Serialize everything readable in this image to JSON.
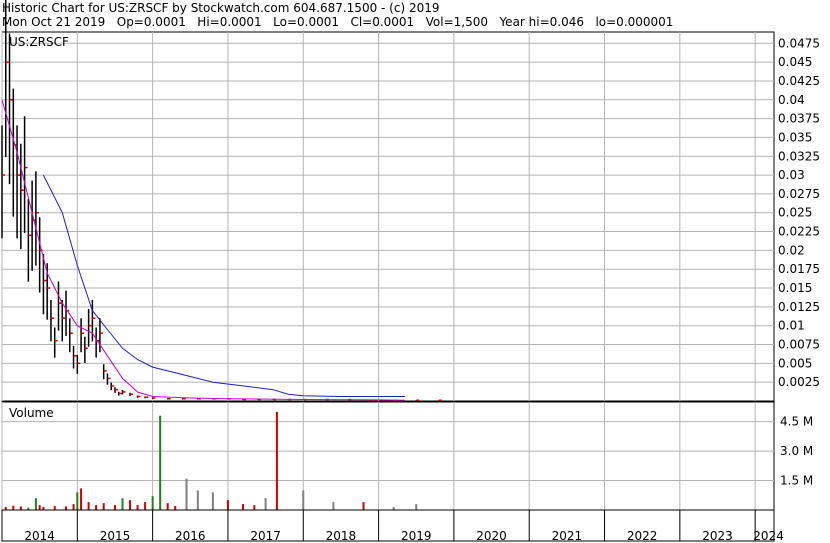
{
  "header": {
    "line1": "Historic Chart for US:ZRSCF by Stockwatch.com 604.687.1500 - (c) 2019",
    "line2": "Mon Oct 21 2019   Op=0.0001   Hi=0.0001   Lo=0.0001   Cl=0.0001   Vol=1,500   Year hi=0.046   lo=0.000001"
  },
  "colors": {
    "grid": "#b4b4b4",
    "up": "#208020",
    "down": "#d00000",
    "neutral": "#808080",
    "ma_short": "#d000d0",
    "ma_long": "#2020c0",
    "price_bar": "#000000"
  },
  "chart_data": [
    {
      "type": "line",
      "title": "US:ZRSCF",
      "y_ticks": [
        "0.0475",
        "0.045",
        "0.0425",
        "0.04",
        "0.0375",
        "0.035",
        "0.0325",
        "0.03",
        "0.0275",
        "0.025",
        "0.0225",
        "0.02",
        "0.0175",
        "0.015",
        "0.0125",
        "0.01",
        "0.0075",
        "0.005",
        "0.0025"
      ],
      "ylim": [
        0,
        0.049
      ],
      "x_ticks": [
        "2014",
        "2015",
        "2016",
        "2017",
        "2018",
        "2019",
        "2020",
        "2021",
        "2022",
        "2023",
        "2024"
      ],
      "xlim": [
        2014.0,
        2024.25
      ],
      "grid": true,
      "series": [
        {
          "style": "ohlc",
          "x": [
            2014.0,
            2014.05,
            2014.1,
            2014.15,
            2014.2,
            2014.25,
            2014.3,
            2014.35,
            2014.4,
            2014.45,
            2014.5,
            2014.55,
            2014.6,
            2014.65,
            2014.7,
            2014.75,
            2014.8,
            2014.85,
            2014.9,
            2014.95,
            2015.0,
            2015.05,
            2015.1,
            2015.15,
            2015.2,
            2015.25,
            2015.3,
            2015.35,
            2015.4,
            2015.45,
            2015.5,
            2015.55,
            2015.6,
            2015.7,
            2015.8,
            2015.9,
            2016.0,
            2016.2,
            2016.4,
            2016.6,
            2016.8,
            2017.0,
            2017.2,
            2017.4,
            2017.6,
            2017.8,
            2018.0,
            2018.3,
            2018.6,
            2018.9,
            2019.2,
            2019.5,
            2019.8
          ],
          "y": [
            0.03,
            0.045,
            0.04,
            0.034,
            0.03,
            0.028,
            0.031,
            0.022,
            0.024,
            0.025,
            0.02,
            0.016,
            0.015,
            0.011,
            0.008,
            0.013,
            0.011,
            0.012,
            0.009,
            0.006,
            0.005,
            0.009,
            0.007,
            0.01,
            0.011,
            0.008,
            0.009,
            0.004,
            0.003,
            0.002,
            0.0015,
            0.001,
            0.0012,
            0.0009,
            0.0006,
            0.0005,
            0.0004,
            0.0003,
            0.0003,
            0.0003,
            0.0003,
            0.0003,
            0.0002,
            0.0002,
            0.0002,
            0.0002,
            0.0002,
            0.0002,
            0.0002,
            0.0001,
            0.0001,
            0.0001,
            0.0001
          ]
        },
        {
          "style": "moving-average",
          "color": "#d000d0",
          "x": [
            2014.0,
            2014.2,
            2014.4,
            2014.6,
            2014.8,
            2015.0,
            2015.2,
            2015.4,
            2015.6,
            2015.8,
            2016.0,
            2016.5,
            2017.0,
            2018.0,
            2019.0,
            2019.35
          ],
          "y": [
            0.04,
            0.033,
            0.025,
            0.017,
            0.013,
            0.01,
            0.009,
            0.006,
            0.003,
            0.0012,
            0.0006,
            0.0004,
            0.0003,
            0.0002,
            0.00015,
            0.0001
          ]
        },
        {
          "style": "moving-average",
          "color": "#2020c0",
          "x": [
            2014.55,
            2014.8,
            2015.0,
            2015.2,
            2015.4,
            2015.6,
            2015.8,
            2016.0,
            2016.4,
            2016.8,
            2017.2,
            2017.6,
            2017.8,
            2018.0,
            2018.5,
            2019.0,
            2019.35
          ],
          "y": [
            0.03,
            0.025,
            0.018,
            0.012,
            0.0095,
            0.007,
            0.0055,
            0.0045,
            0.0035,
            0.0025,
            0.002,
            0.0015,
            0.0009,
            0.0007,
            0.0006,
            0.0006,
            0.0006
          ]
        }
      ]
    },
    {
      "type": "bar",
      "title": "Volume",
      "y_ticks": [
        "4.5 M",
        "3.0 M",
        "1.5 M"
      ],
      "ylim": [
        0,
        5500000
      ],
      "x": [
        2014.05,
        2014.15,
        2014.25,
        2014.35,
        2014.45,
        2014.5,
        2014.55,
        2014.7,
        2014.85,
        2014.95,
        2015.0,
        2015.05,
        2015.15,
        2015.25,
        2015.35,
        2015.5,
        2015.6,
        2015.7,
        2015.8,
        2015.9,
        2016.0,
        2016.1,
        2016.2,
        2016.3,
        2016.45,
        2016.6,
        2016.8,
        2017.0,
        2017.2,
        2017.35,
        2017.5,
        2017.65,
        2018.0,
        2018.4,
        2018.8,
        2019.2,
        2019.5
      ],
      "values": [
        150000,
        220000,
        180000,
        120000,
        600000,
        250000,
        150000,
        200000,
        180000,
        300000,
        900000,
        1100000,
        400000,
        250000,
        350000,
        250000,
        600000,
        500000,
        250000,
        400000,
        700000,
        4800000,
        350000,
        200000,
        1600000,
        1000000,
        900000,
        500000,
        300000,
        250000,
        600000,
        5000000,
        1000000,
        400000,
        400000,
        150000,
        300000
      ],
      "colors": [
        "red",
        "red",
        "red",
        "green",
        "green",
        "red",
        "red",
        "red",
        "red",
        "red",
        "green",
        "red",
        "red",
        "red",
        "red",
        "red",
        "green",
        "red",
        "red",
        "red",
        "green",
        "green",
        "red",
        "red",
        "gray",
        "gray",
        "gray",
        "red",
        "red",
        "red",
        "gray",
        "red",
        "gray",
        "gray",
        "red",
        "gray",
        "gray"
      ]
    }
  ]
}
